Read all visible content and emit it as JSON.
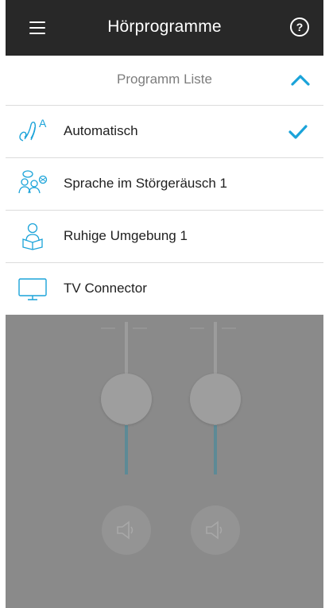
{
  "header": {
    "title": "Hörprogramme",
    "help_label": "?"
  },
  "program_list": {
    "header_label": "Programm Liste",
    "items": [
      {
        "label": "Automatisch",
        "icon": "hearing-aid-auto-icon",
        "selected": true
      },
      {
        "label": "Sprache im Störgeräusch 1",
        "icon": "speech-in-noise-icon",
        "selected": false
      },
      {
        "label": "Ruhige Umgebung 1",
        "icon": "quiet-reading-icon",
        "selected": false
      },
      {
        "label": "TV Connector",
        "icon": "tv-icon",
        "selected": false
      }
    ]
  },
  "colors": {
    "header_bg": "#282828",
    "accent": "#1aa3d9",
    "icon": "#1aa3d9",
    "overlay": "#8a8a8a"
  }
}
